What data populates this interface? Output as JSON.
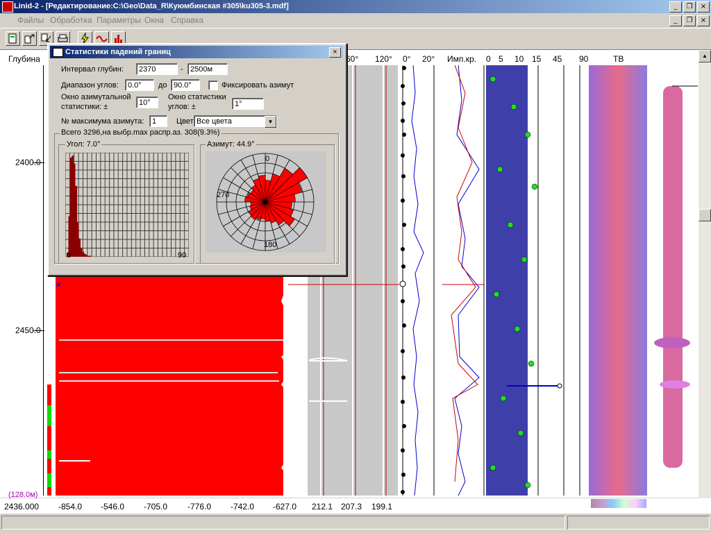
{
  "window": {
    "title": "Linid-2 - [Редактирование:C:\\Geo\\Data_R\\Куюмбинская #305\\ku305-3.mdf]"
  },
  "menu": [
    "Файлы",
    "Обработка",
    "Параметры",
    "Окна",
    "Справка"
  ],
  "columns": {
    "depth": "Глубина",
    "h60": "60°",
    "h120": "120°",
    "h0": "0°",
    "h20": "20°",
    "imp": "Имп.кр.",
    "s0": "0",
    "s5": "5",
    "s10": "10",
    "s15": "15",
    "s45": "45",
    "s90": "90",
    "tv": "ТВ"
  },
  "depth_ticks": [
    "2400.0",
    "2450.0"
  ],
  "footer": {
    "scale": "(128.0м)",
    "start_depth": "2436.000",
    "values": [
      "-854.0",
      "-546.0",
      "-705.0",
      "-776.0",
      "-742.0",
      "-627.0",
      "212.1",
      "207.3",
      "199.1"
    ]
  },
  "dialog": {
    "title": "Статистики падений границ",
    "depth_interval_label": "Интервал глубин:",
    "depth_from": "2370",
    "depth_sep": "-",
    "depth_to": "2500м",
    "angle_range_label": "Диапазон углов:",
    "angle_from": "0.0°",
    "angle_to_label": "до",
    "angle_to": "90.0°",
    "fix_azimuth_label": "Фиксировать азимут",
    "fix_azimuth_checked": false,
    "az_window_label_1": "Окно азимутальной",
    "az_window_label_2": "статистики: ±",
    "az_window_value": "10°",
    "angle_window_label_1": "Окно статистики",
    "angle_window_label_2": "углов: ±",
    "angle_window_value": "1°",
    "max_az_label": "№ максимума азимута:",
    "max_az_value": "1",
    "color_label": "Цвет:",
    "color_value": "Все цвета",
    "summary": "Всего 3296,на выбр.max распр.аз. 308(9.3%)",
    "angle_group": "Угол: 7.0°",
    "angle_axis_min": "0",
    "angle_axis_max": "90",
    "azimuth_group": "Азимут: 44.9°",
    "rose_n": "0",
    "rose_w": "270",
    "rose_s": "180",
    "accent": "#ff0000"
  },
  "histogram_data": {
    "type": "bar",
    "xlim": [
      0,
      90
    ],
    "values": [
      4,
      40,
      98,
      100,
      92,
      70,
      34,
      18,
      9,
      5,
      3,
      2,
      1,
      1
    ]
  },
  "rose_data": {
    "type": "rose",
    "bins_deg": [
      0,
      15,
      30,
      45,
      60,
      75,
      90,
      105,
      120,
      135,
      150,
      165,
      180,
      195,
      210,
      225,
      240,
      255,
      270,
      285,
      300,
      315,
      330,
      345
    ],
    "values": [
      0.45,
      0.6,
      0.8,
      1.0,
      0.78,
      0.62,
      0.55,
      0.6,
      0.7,
      0.55,
      0.45,
      0.4,
      0.35,
      0.38,
      0.42,
      0.4,
      0.33,
      0.3,
      0.42,
      0.38,
      0.35,
      0.4,
      0.5,
      0.55
    ]
  },
  "toolbar_icons": [
    "open-icon",
    "export-icon",
    "import-icon",
    "print-icon",
    "lightning-icon",
    "wave-icon",
    "histogram-icon"
  ]
}
